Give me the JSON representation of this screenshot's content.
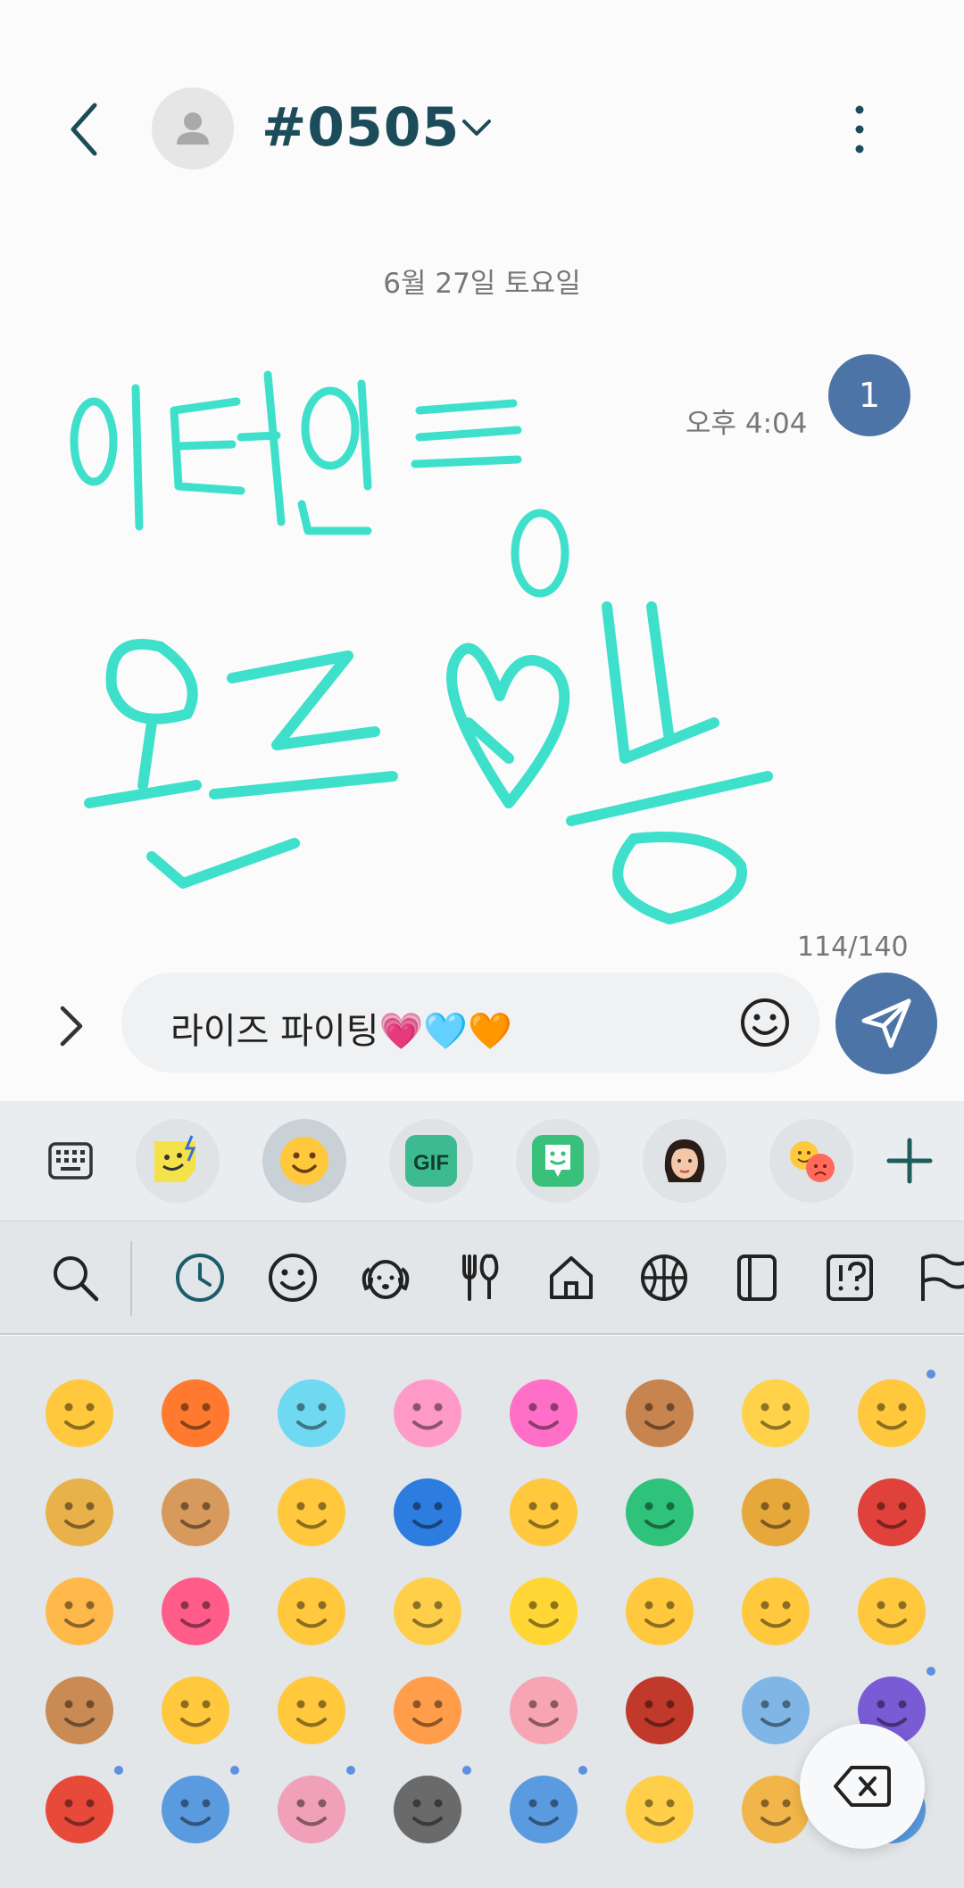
{
  "header": {
    "title": "#0505",
    "icons": [
      "back-icon",
      "person-icon",
      "chevron-down-icon",
      "more-vertical-icon"
    ]
  },
  "conversation": {
    "date_separator": "6월 27일 토요일",
    "message_time": "오후 4:04",
    "unread_count": "1",
    "drawing_color": "#3fe0cb"
  },
  "composer": {
    "char_counter": "114/140",
    "input_value": "라이즈 파이팅💗🩵🧡",
    "send_color": "#4d74a6"
  },
  "keyboard_toolbar": {
    "items": [
      "keyboard-icon",
      "sticker-icon",
      "emoji-icon",
      "gif-icon",
      "bitmoji-icon",
      "ar-emoji-avatar-icon",
      "mood-emoji-icon",
      "add-icon"
    ],
    "gif_label": "GIF"
  },
  "emoji_categories": [
    "search-icon",
    "recent-icon",
    "smileys-icon",
    "animals-icon",
    "food-icon",
    "places-icon",
    "activities-icon",
    "objects-icon",
    "symbols-icon",
    "flags-icon"
  ],
  "emoji_grid": [
    [
      "😆",
      "🧡",
      "🩵",
      "🩷",
      "💕",
      "🚪",
      "😇",
      "👍"
    ],
    [
      "🌕",
      "🐶",
      "🤤",
      "💙",
      "😪",
      "💚",
      "🍯",
      "🍄"
    ],
    [
      "🥰",
      "🎉",
      "🥹",
      "🎊",
      "💛",
      "😍",
      "😭",
      "😋"
    ],
    [
      "🍪",
      "😘",
      "🥺",
      "🌅",
      "🐷",
      "🥣",
      "🏢",
      "🕺"
    ],
    [
      "💃",
      "🧑‍🔬",
      "👩‍🔬",
      "👩‍💻",
      "👨‍🔬",
      "⚡",
      "🫶",
      "👨‍🔬"
    ]
  ],
  "colors": {
    "accent": "#4d74a6",
    "title": "#1c4c5a",
    "keyboard_bg": "#e2e6e9"
  }
}
